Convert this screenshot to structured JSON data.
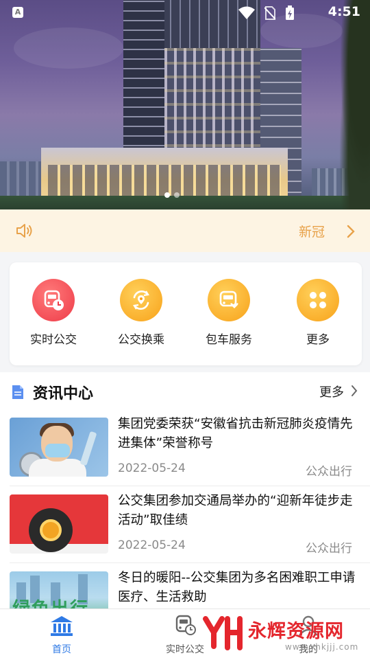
{
  "status_bar": {
    "app_badge": "A",
    "time": "4:51",
    "icons": [
      "wifi-icon",
      "no-sim-icon",
      "battery-charging-icon"
    ]
  },
  "banner": {
    "description_icon": "building-photo",
    "dots": 2,
    "active_dot": 1
  },
  "notice": {
    "icon": "speaker-icon",
    "text": "新冠",
    "chevron": "chevron-right-icon"
  },
  "quick_access": [
    {
      "label": "实时公交",
      "icon": "bus-clock-icon",
      "color": "#ee3b48"
    },
    {
      "label": "公交换乘",
      "icon": "transfer-location-icon",
      "color": "#f8a21a"
    },
    {
      "label": "包车服务",
      "icon": "charter-bus-icon",
      "color": "#f8a21a"
    },
    {
      "label": "更多",
      "icon": "grid-more-icon",
      "color": "#f8a21a"
    }
  ],
  "news": {
    "title": "资讯中心",
    "more": "更多",
    "items": [
      {
        "title": "集团党委荣获“安徽省抗击新冠肺炎疫情先进集体”荣誉称号",
        "date": "2022-05-24",
        "source": "公众出行"
      },
      {
        "title": "公交集团参加交通局举办的“迎新年徒步走活动”取佳绩",
        "date": "2022-05-24",
        "source": "公众出行"
      },
      {
        "title": "冬日的暖阳--公交集团为多名困难职工申请医疗、生活救助",
        "date": "",
        "source": ""
      }
    ],
    "thumb3_text": "绿色出行"
  },
  "bottom_nav": [
    {
      "label": "首页",
      "icon": "home-bank-icon",
      "active": true
    },
    {
      "label": "实时公交",
      "icon": "bus-clock-icon",
      "active": false
    },
    {
      "label": "我的",
      "icon": "user-icon",
      "active": false
    }
  ],
  "watermark": {
    "logo_text": "YH",
    "name": "永辉资源网",
    "url": "www.yhkjjj.com"
  },
  "colors": {
    "accent_blue": "#2f7ae5",
    "notice_bg": "#fdf4e3",
    "notice_text": "#e8a24a",
    "red": "#ee3b48",
    "orange": "#f8a21a"
  }
}
